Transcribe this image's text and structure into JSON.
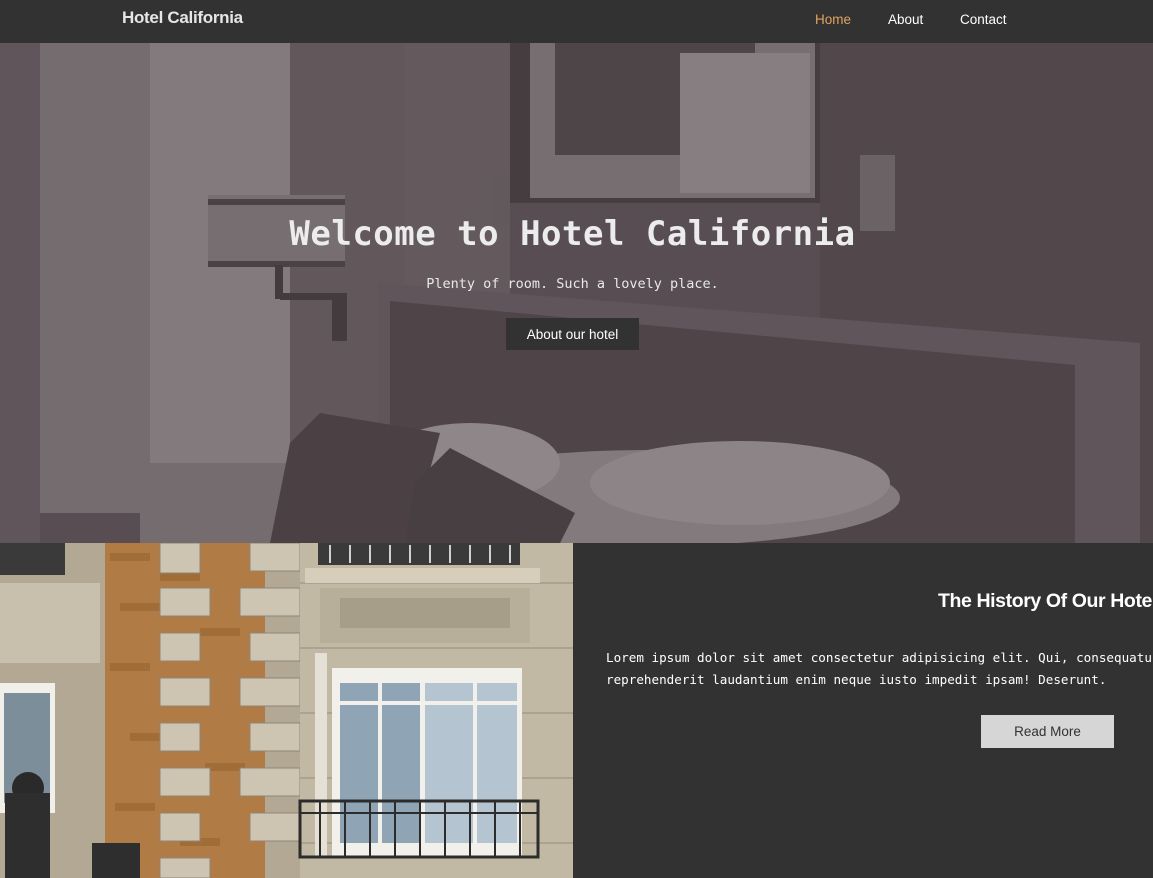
{
  "navbar": {
    "brand": "Hotel California",
    "links": [
      {
        "label": "Home",
        "active": true
      },
      {
        "label": "About",
        "active": false
      },
      {
        "label": "Contact",
        "active": false
      }
    ]
  },
  "hero": {
    "title": "Welcome to Hotel California",
    "subtitle": "Plenty of room. Such a lovely place.",
    "button_label": "About our hotel"
  },
  "history": {
    "title": "The History Of Our Hotel",
    "text": "Lorem ipsum dolor sit amet consectetur adipisicing elit. Qui, consequatur aperiam reprehenderit laudantium enim neque iusto impedit ipsam! Deserunt.",
    "button_label": "Read More"
  },
  "colors": {
    "background": "#333232",
    "active_link": "#e0a35f",
    "read_more_bg": "#d6d6d6"
  }
}
